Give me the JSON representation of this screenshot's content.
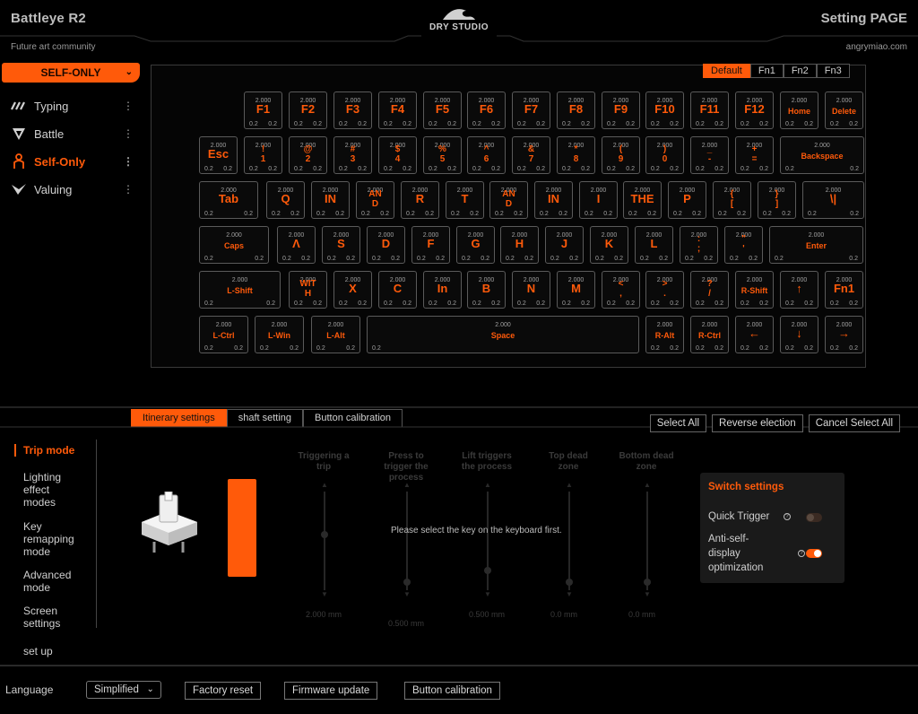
{
  "header": {
    "app_title": "Battleye R2",
    "subtitle": "Future art community",
    "logo_text": "DRY STUDIO",
    "page_title": "Setting PAGE",
    "site": "angrymiao.com"
  },
  "sidebar": {
    "mode_select": "SELF-ONLY",
    "items": [
      {
        "label": "Typing",
        "icon": "typing-icon"
      },
      {
        "label": "Battle",
        "icon": "battle-icon"
      },
      {
        "label": "Self-Only",
        "icon": "self-only-icon",
        "active": true
      },
      {
        "label": "Valuing",
        "icon": "valuing-icon"
      }
    ]
  },
  "layers": [
    "Default",
    "Fn1",
    "Fn2",
    "Fn3"
  ],
  "key_defaults": {
    "value": "2.000",
    "left": "0.2",
    "right": "0.2"
  },
  "keyboard": [
    [
      "F1",
      "F2",
      "F3",
      "F4",
      "F5",
      "F6",
      "F7",
      "F8",
      "F9",
      "F10",
      "F11",
      "F12",
      "Home",
      "Delete"
    ],
    [
      "Esc",
      "!\n1",
      "@\n2",
      "#\n3",
      "$\n4",
      "%\n5",
      "^\n6",
      "&\n7",
      "*\n8",
      "(\n9",
      ")\n0",
      "_\n-",
      "+\n=",
      "Backspace"
    ],
    [
      "Tab",
      "Q",
      "IN",
      "AN\nD",
      "R",
      "T",
      "AN\nD",
      "IN",
      "I",
      "THE",
      "P",
      "{\n[",
      "}\n]",
      "\\|"
    ],
    [
      "Caps",
      "Λ",
      "S",
      "D",
      "F",
      "G",
      "H",
      "J",
      "K",
      "L",
      ":\n;",
      "\"\n'",
      "Enter"
    ],
    [
      "L-Shift",
      "WIT\nH",
      "X",
      "C",
      "In",
      "B",
      "N",
      "M",
      "<\n,",
      ">\n.",
      "?\n/",
      "R-Shift",
      "↑",
      "Fn1"
    ],
    [
      "L-Ctrl",
      "L-Win",
      "L-Alt",
      "Space",
      "R-Alt",
      "R-Ctrl",
      "←",
      "↓",
      "→"
    ]
  ],
  "bottom": {
    "tabs": [
      "Itinerary settings",
      "shaft setting",
      "Button calibration"
    ],
    "selection_buttons": [
      "Select All",
      "Reverse election",
      "Cancel Select All"
    ],
    "nav": [
      "Trip mode",
      "Lighting\neffect\nmodes",
      "Key\nremapping\nmode",
      "Advanced\nmode",
      "Screen\nsettings"
    ],
    "setup": "set up",
    "columns": [
      {
        "title": "Triggering a\ntrip",
        "value": "2.000",
        "unit": "mm"
      },
      {
        "title": "Press to\ntrigger the\nprocess",
        "value": "0.500",
        "unit": "mm"
      },
      {
        "title": "Lift triggers\nthe process",
        "value": "0.500",
        "unit": "mm"
      },
      {
        "title": "Top dead\nzone",
        "value": "0.0",
        "unit": "mm"
      },
      {
        "title": "Bottom dead\nzone",
        "value": "0.0",
        "unit": "mm"
      }
    ],
    "hint": "Please select the key on the keyboard first.",
    "switch_settings": {
      "title": "Switch settings",
      "quick_trigger": "Quick Trigger",
      "quick_trigger_on": false,
      "anti_self": "Anti-self-\ndisplay\noptimization",
      "anti_self_on": true
    }
  },
  "footer": {
    "language_label": "Language",
    "language_value": "Simplified",
    "buttons": [
      "Factory reset",
      "Firmware update",
      "Button calibration"
    ]
  },
  "colors": {
    "accent": "#ff5a0a",
    "background": "#000000"
  }
}
